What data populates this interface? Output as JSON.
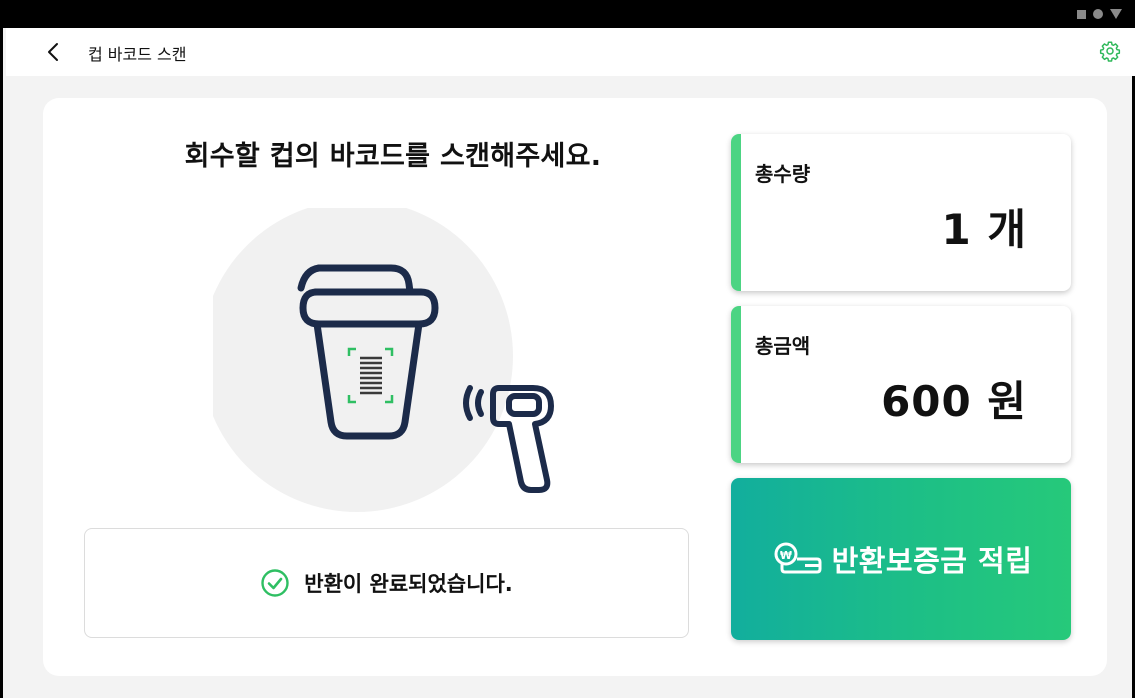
{
  "app": {
    "title": "컵 바코드 스캔",
    "icons": {
      "back": "chevron-left-icon",
      "settings": "gear-icon"
    }
  },
  "main": {
    "instruction": "회수할 컵의 바코드를 스캔해주세요.",
    "illustration": {
      "icons": [
        "cup-icon",
        "barcode-icon",
        "barcode-scanner-icon"
      ]
    },
    "result": {
      "icon": "check-circle-icon",
      "message": "반환이 완료되었습니다."
    }
  },
  "summary": {
    "quantity": {
      "label": "총수량",
      "value": "1 개"
    },
    "amount": {
      "label": "총금액",
      "value": "600 원"
    }
  },
  "action": {
    "label": "반환보증금 적립",
    "icon": "won-coin-card-icon"
  },
  "colors": {
    "accent": "#4cd483",
    "button_gradient_start": "#12ae9d",
    "button_gradient_end": "#26c97a",
    "icon_stroke": "#1c2b4a",
    "settings_icon": "#2fb85a"
  }
}
